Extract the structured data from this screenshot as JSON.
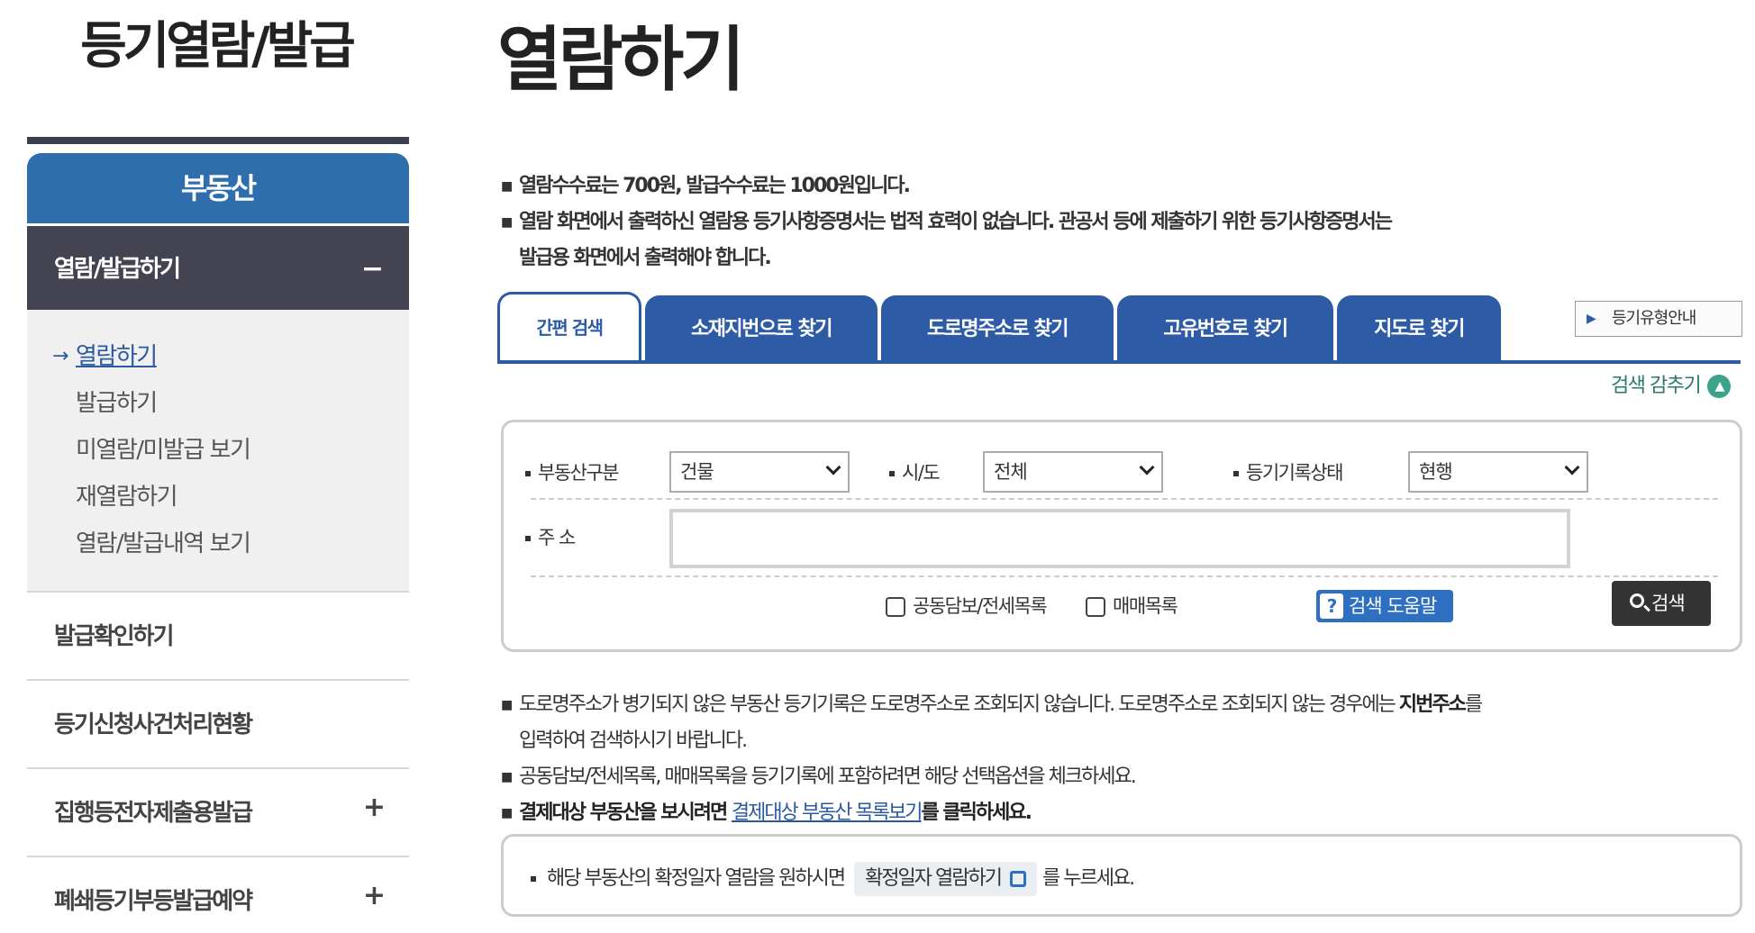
{
  "sidebar": {
    "title": "등기열람/발급",
    "category": "부동산",
    "group": {
      "label": "열람/발급하기",
      "toggle": "−"
    },
    "sub_items": [
      {
        "label": "열람하기",
        "active": true,
        "arrow": "→"
      },
      {
        "label": "발급하기",
        "active": false
      },
      {
        "label": "미열람/미발급 보기",
        "active": false
      },
      {
        "label": "재열람하기",
        "active": false
      },
      {
        "label": "열람/발급내역 보기",
        "active": false
      }
    ],
    "menus": [
      {
        "label": "발급확인하기",
        "toggle": ""
      },
      {
        "label": "등기신청사건처리현황",
        "toggle": ""
      },
      {
        "label": "집행등전자제출용발급",
        "toggle": "+"
      },
      {
        "label": "폐쇄등기부등발급예약",
        "toggle": "+"
      }
    ]
  },
  "main": {
    "title": "열람하기",
    "notices": [
      "열람수수료는 700원, 발급수수료는 1000원입니다.",
      "열람 화면에서 출력하신 열람용 등기사항증명서는 법적 효력이 없습니다. 관공서 등에 제출하기 위한 등기사항증명서는",
      "발급용 화면에서 출력해야 합니다."
    ],
    "tabs": [
      "간편 검색",
      "소재지번으로 찾기",
      "도로명주소로 찾기",
      "고유번호로 찾기",
      "지도로 찾기"
    ],
    "guide_button": "등기유형안내",
    "collapse_label": "검색 감추기",
    "search": {
      "property_type_label": "부동산구분",
      "property_type_value": "건물",
      "sido_label": "시/도",
      "sido_value": "전체",
      "status_label": "등기기록상태",
      "status_value": "현행",
      "address_label": "주 소",
      "address_value": "",
      "check1": "공동담보/전세목록",
      "check2": "매매목록",
      "help_label": "검색 도움말",
      "search_label": "검색"
    },
    "bottom_notes": {
      "n1a": "도로명주소가 병기되지 않은 부동산 등기기록은 도로명주소로 조회되지 않습니다. 도로명주소로 조회되지 않는 경우에는 ",
      "n1b": "지번주소",
      "n1c": "를",
      "n1d": "입력하여 검색하시기 바랍니다.",
      "n2": "공동담보/전세목록, 매매목록을 등기기록에 포함하려면 해당 선택옵션을 체크하세요.",
      "n3a": "결제대상 부동산을 보시려면 ",
      "n3link": "결제대상 부동산 목록보기",
      "n3b": "를 클릭하세요."
    },
    "confirm": {
      "prefix": "해당 부동산의 확정일자 열람을 원하시면",
      "button": "확정일자 열람하기",
      "suffix": "를 누르세요."
    }
  }
}
